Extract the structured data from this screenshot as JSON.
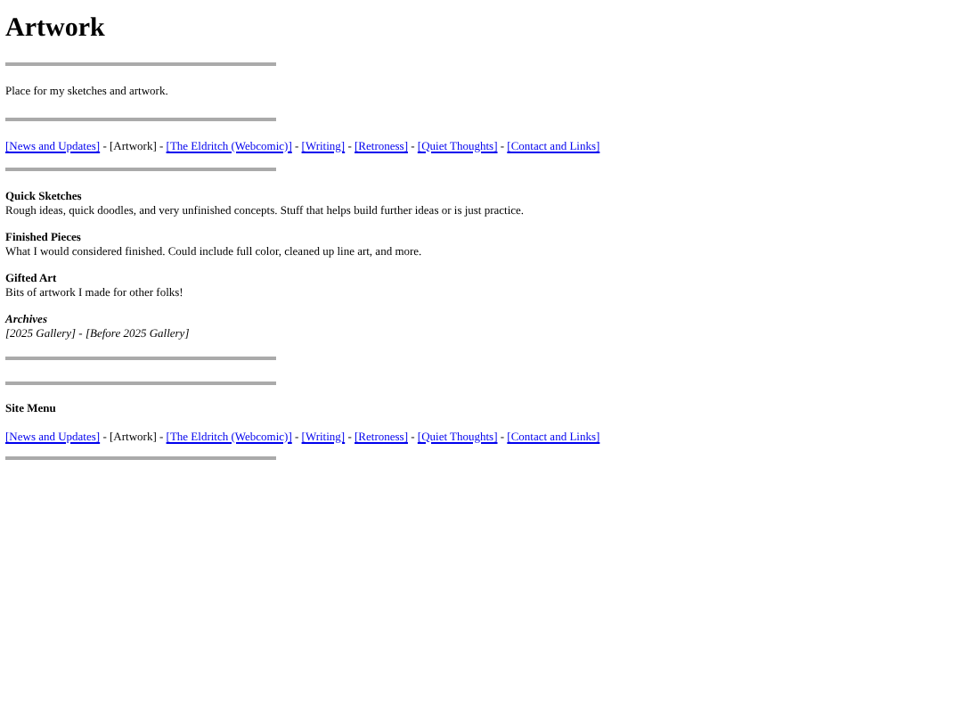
{
  "title": "Artwork",
  "intro": "Place for my sketches and artwork.",
  "nav_separator": "-",
  "nav": [
    {
      "label": "[News and Updates]",
      "kind": "link"
    },
    {
      "label": "[Artwork]",
      "kind": "current"
    },
    {
      "label": "[The Eldritch (Webcomic)]",
      "kind": "link"
    },
    {
      "label": "[Writing]",
      "kind": "link"
    },
    {
      "label": "[Retroness]",
      "kind": "link"
    },
    {
      "label": "[Quiet Thoughts]",
      "kind": "link"
    },
    {
      "label": "[Contact and Links]",
      "kind": "link"
    }
  ],
  "sections": [
    {
      "heading": "Quick Sketches",
      "text": "Rough ideas, quick doodles, and very unfinished concepts. Stuff that helps build further ideas or is just practice."
    },
    {
      "heading": "Finished Pieces",
      "text": "What I would considered finished. Could include full color, cleaned up line art, and more."
    },
    {
      "heading": "Gifted Art",
      "text": "Bits of artwork I made for other folks!"
    }
  ],
  "archives": {
    "heading": "Archives",
    "separator": "-",
    "items": [
      "[2025 Gallery]",
      "[Before 2025 Gallery]"
    ]
  },
  "site_menu": {
    "heading": "Site Menu",
    "separator": "-",
    "nav": [
      {
        "label": "[News and Updates]",
        "kind": "link"
      },
      {
        "label": "[Artwork]",
        "kind": "current"
      },
      {
        "label": "[The Eldritch (Webcomic)]",
        "kind": "link"
      },
      {
        "label": "[Writing]",
        "kind": "link"
      },
      {
        "label": "[Retroness]",
        "kind": "link"
      },
      {
        "label": "[Quiet Thoughts]",
        "kind": "link"
      },
      {
        "label": "[Contact and Links]",
        "kind": "link"
      }
    ]
  }
}
